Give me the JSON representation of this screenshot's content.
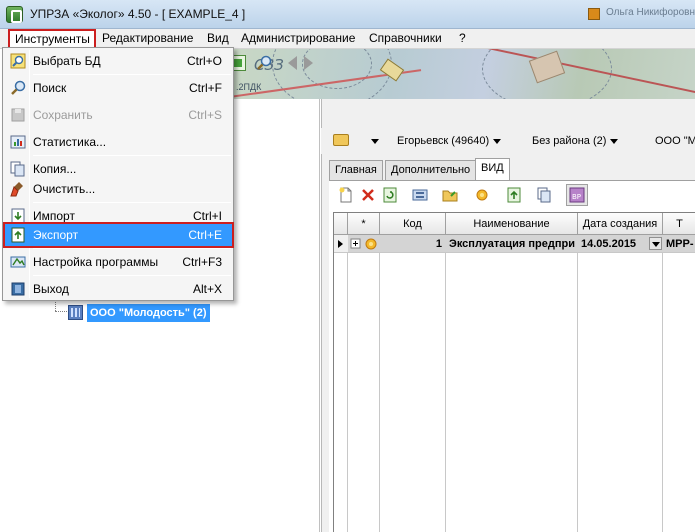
{
  "window": {
    "title": "УПРЗА «Эколог» 4.50 - [ EXAMPLE_4 ]",
    "title_right_text": "Ольга Никифоровна"
  },
  "menubar": {
    "items": [
      "Инструменты",
      "Редактирование",
      "Вид",
      "Администрирование",
      "Справочники",
      "?"
    ]
  },
  "dropdown": {
    "items": [
      {
        "label": "Выбрать БД",
        "shortcut": "Ctrl+O",
        "icon": "select-db-icon"
      },
      {
        "label": "Поиск",
        "shortcut": "Ctrl+F",
        "icon": "search-icon"
      },
      {
        "label": "Сохранить",
        "shortcut": "Ctrl+S",
        "icon": "save-icon",
        "disabled": true
      },
      {
        "label": "Статистика...",
        "shortcut": "",
        "icon": "statistics-icon"
      },
      {
        "label": "Копия...",
        "shortcut": "",
        "icon": "copy-icon"
      },
      {
        "label": "Очистить...",
        "shortcut": "",
        "icon": "clear-icon"
      },
      {
        "label": "Импорт",
        "shortcut": "Ctrl+I",
        "icon": "import-icon"
      },
      {
        "label": "Экспорт",
        "shortcut": "Ctrl+E",
        "icon": "export-icon",
        "highlighted": true
      },
      {
        "label": "Настройка программы",
        "shortcut": "Ctrl+F3",
        "icon": "settings-icon"
      },
      {
        "label": "Выход",
        "shortcut": "Alt+X",
        "icon": "exit-icon"
      }
    ]
  },
  "map": {
    "label_szz": "СЗЗ",
    "label_2pdk": ".2ПДК"
  },
  "tree": {
    "selected_node": "ООО \"Молодость\" (2)"
  },
  "location_bar": {
    "city": "Егорьевск (49640)",
    "district": "Без района (2)",
    "company": "ООО \"М"
  },
  "tabs": [
    "Главная",
    "Дополнительно",
    "ВИД"
  ],
  "grid": {
    "columns": [
      "*",
      "Код",
      "Наименование",
      "Дата создания",
      "Т"
    ],
    "rows": [
      {
        "code": "1",
        "name": "Эксплуатация предпри",
        "date": "14.05.2015",
        "type": "МРР-"
      }
    ]
  },
  "colors": {
    "highlight": "#3399ff",
    "annotation_red": "#cc1f1f"
  }
}
